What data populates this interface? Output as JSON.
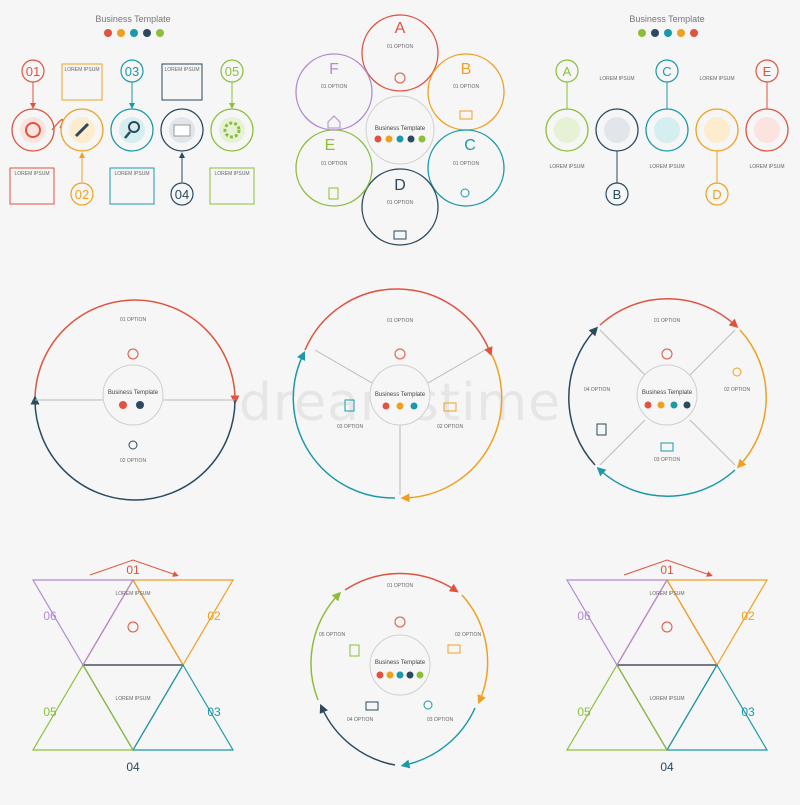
{
  "colors": {
    "red": "#e0533f",
    "orange": "#f0a020",
    "teal": "#1a9aa8",
    "navy": "#2b4a60",
    "green": "#8bbf3a",
    "purple": "#b28ad4",
    "gray": "#bdbdbd"
  },
  "texts": {
    "business_template": "Business Template",
    "lorem_ipsum": "LOREM IPSUM",
    "o1": "01 OPTION",
    "o2": "02 OPTION",
    "o3": "03 OPTION",
    "o4": "04 OPTION",
    "o5": "05 OPTION",
    "n01": "01",
    "n02": "02",
    "n03": "03",
    "n04": "04",
    "n05": "05",
    "n06": "06",
    "A": "A",
    "B": "B",
    "C": "C",
    "D": "D",
    "E": "E",
    "F": "F"
  },
  "icons": [
    "target-icon",
    "rocket-icon",
    "magnifier-icon",
    "mail-icon",
    "gear-icon",
    "globe-icon",
    "laptop-icon",
    "document-icon",
    "home-icon",
    "pin-icon",
    "bulb-icon",
    "monitor-icon"
  ],
  "watermark": "dreamstime"
}
